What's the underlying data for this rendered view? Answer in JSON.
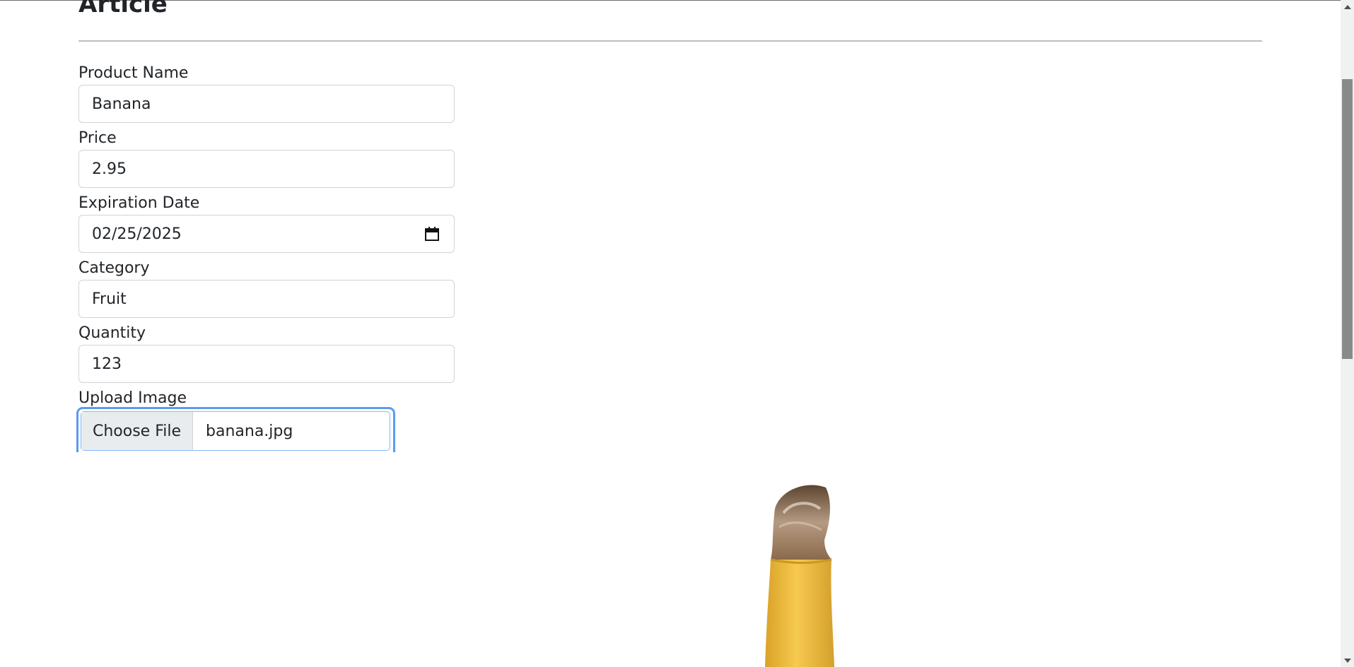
{
  "page": {
    "title": "Article"
  },
  "form": {
    "product_name": {
      "label": "Product Name",
      "value": "Banana"
    },
    "price": {
      "label": "Price",
      "value": "2.95"
    },
    "expiration_date": {
      "label": "Expiration Date",
      "value": "02/25/2025"
    },
    "category": {
      "label": "Category",
      "value": "Fruit"
    },
    "quantity": {
      "label": "Quantity",
      "value": "123"
    },
    "upload": {
      "label": "Upload Image",
      "button_label": "Choose File",
      "file_name": "banana.jpg"
    }
  },
  "icons": {
    "date": "calendar-icon",
    "scroll_up": "scroll-up-arrow-icon",
    "scroll_down": "scroll-down-arrow-icon"
  },
  "colors": {
    "focus": "#5a9bf0",
    "banana_yellow": "#f2c14a",
    "banana_tip": "#7a5a3a"
  }
}
